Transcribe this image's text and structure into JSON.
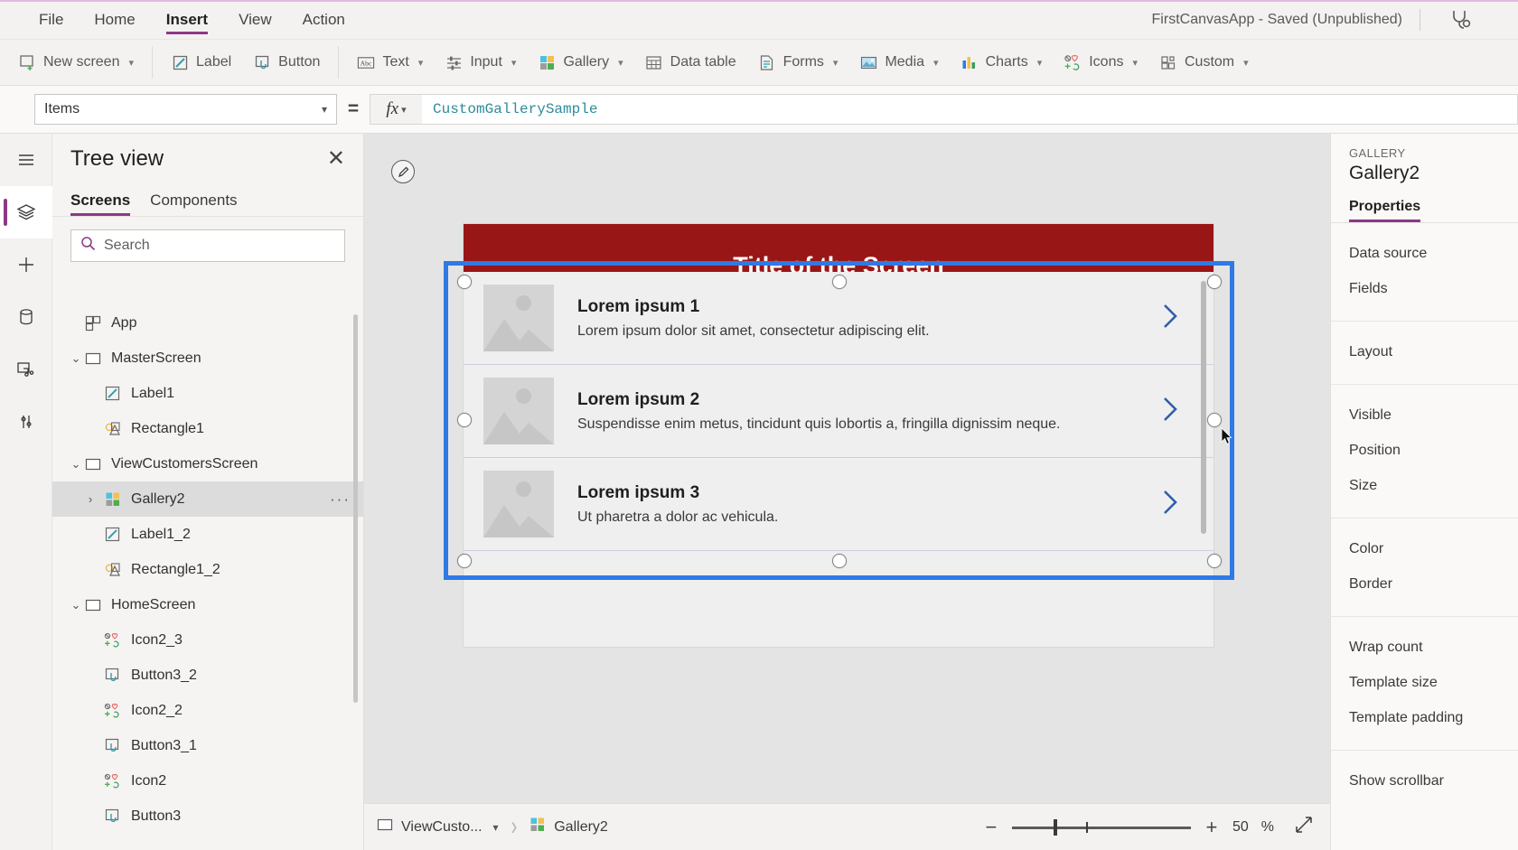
{
  "menubar": {
    "items": [
      {
        "label": "File",
        "active": false
      },
      {
        "label": "Home",
        "active": false
      },
      {
        "label": "Insert",
        "active": true
      },
      {
        "label": "View",
        "active": false
      },
      {
        "label": "Action",
        "active": false
      }
    ],
    "app_status": "FirstCanvasApp - Saved (Unpublished)",
    "right_icon": "app-checker-icon"
  },
  "ribbon": {
    "buttons": [
      {
        "label": "New screen",
        "icon": "new-screen-icon",
        "caret": true
      },
      {
        "label": "Label",
        "icon": "label-icon",
        "caret": false
      },
      {
        "label": "Button",
        "icon": "button-icon",
        "caret": false
      },
      {
        "label": "Text",
        "icon": "text-icon",
        "caret": true
      },
      {
        "label": "Input",
        "icon": "input-icon",
        "caret": true
      },
      {
        "label": "Gallery",
        "icon": "gallery-icon",
        "caret": true
      },
      {
        "label": "Data table",
        "icon": "data-table-icon",
        "caret": false
      },
      {
        "label": "Forms",
        "icon": "forms-icon",
        "caret": true
      },
      {
        "label": "Media",
        "icon": "media-icon",
        "caret": true
      },
      {
        "label": "Charts",
        "icon": "charts-icon",
        "caret": true
      },
      {
        "label": "Icons",
        "icon": "icons-icon",
        "caret": true
      },
      {
        "label": "Custom",
        "icon": "custom-icon",
        "caret": true
      }
    ]
  },
  "formulabar": {
    "property": "Items",
    "equals": "=",
    "fx": "fx",
    "formula": "CustomGallerySample"
  },
  "rail": {
    "items": [
      {
        "name": "hamburger-menu-icon",
        "active": false
      },
      {
        "name": "tree-view-icon",
        "active": true
      },
      {
        "name": "insert-plus-icon",
        "active": false
      },
      {
        "name": "data-sources-icon",
        "active": false
      },
      {
        "name": "media-library-icon",
        "active": false
      },
      {
        "name": "variables-icon",
        "active": false
      }
    ]
  },
  "treeview": {
    "title": "Tree view",
    "close": "✕",
    "tabs": [
      {
        "label": "Screens",
        "active": true
      },
      {
        "label": "Components",
        "active": false
      }
    ],
    "search_placeholder": "Search",
    "nodes": [
      {
        "label": "App",
        "level": "app",
        "icon": "app-icon",
        "expander": "",
        "selected": false
      },
      {
        "label": "MasterScreen",
        "level": "screen",
        "icon": "screen-icon",
        "expander": "⌄",
        "selected": false
      },
      {
        "label": "Label1",
        "level": "child",
        "icon": "label-icon",
        "expander": "",
        "selected": false
      },
      {
        "label": "Rectangle1",
        "level": "child",
        "icon": "shape-icon",
        "expander": "",
        "selected": false
      },
      {
        "label": "ViewCustomersScreen",
        "level": "screen",
        "icon": "screen-icon",
        "expander": "⌄",
        "selected": false
      },
      {
        "label": "Gallery2",
        "level": "child",
        "icon": "gallery-icon",
        "expander": "›",
        "selected": true,
        "dots": "···"
      },
      {
        "label": "Label1_2",
        "level": "child",
        "icon": "label-icon",
        "expander": "",
        "selected": false
      },
      {
        "label": "Rectangle1_2",
        "level": "child",
        "icon": "shape-icon",
        "expander": "",
        "selected": false
      },
      {
        "label": "HomeScreen",
        "level": "screen",
        "icon": "screen-icon",
        "expander": "⌄",
        "selected": false
      },
      {
        "label": "Icon2_3",
        "level": "child",
        "icon": "icons-icon",
        "expander": "",
        "selected": false
      },
      {
        "label": "Button3_2",
        "level": "child",
        "icon": "button-icon",
        "expander": "",
        "selected": false
      },
      {
        "label": "Icon2_2",
        "level": "child",
        "icon": "icons-icon",
        "expander": "",
        "selected": false
      },
      {
        "label": "Button3_1",
        "level": "child",
        "icon": "button-icon",
        "expander": "",
        "selected": false
      },
      {
        "label": "Icon2",
        "level": "child",
        "icon": "icons-icon",
        "expander": "",
        "selected": false
      },
      {
        "label": "Button3",
        "level": "child",
        "icon": "button-icon",
        "expander": "",
        "selected": false
      }
    ]
  },
  "canvas": {
    "screen_title": "Title of the Screen",
    "title_bg": "#991616",
    "selection_color": "#2f7ae5",
    "gallery_items": [
      {
        "title": "Lorem ipsum 1",
        "subtitle": "Lorem ipsum dolor sit amet, consectetur adipiscing elit."
      },
      {
        "title": "Lorem ipsum 2",
        "subtitle": "Suspendisse enim metus, tincidunt quis lobortis a, fringilla dignissim neque."
      },
      {
        "title": "Lorem ipsum 3",
        "subtitle": "Ut pharetra a dolor ac vehicula."
      }
    ]
  },
  "rightpanel": {
    "kicker": "GALLERY",
    "control_name": "Gallery2",
    "tab": "Properties",
    "groups": [
      [
        "Data source",
        "Fields"
      ],
      [
        "Layout"
      ],
      [
        "Visible",
        "Position",
        "Size"
      ],
      [
        "Color",
        "Border"
      ],
      [
        "Wrap count",
        "Template size",
        "Template padding"
      ],
      [
        "Show scrollbar"
      ]
    ]
  },
  "statusbar": {
    "breadcrumb_screen": "ViewCusto...",
    "breadcrumb_control": "Gallery2",
    "zoom_minus": "−",
    "zoom_plus": "+",
    "zoom_value": "50",
    "zoom_unit": "%",
    "fit_icon": "fit-to-screen-icon"
  }
}
